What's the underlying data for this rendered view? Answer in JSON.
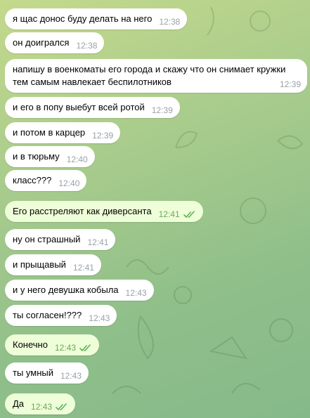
{
  "messages": [
    {
      "text": "я щас донос буду делать на него",
      "time": "12:38",
      "dir": "in"
    },
    {
      "text": "он доигрался",
      "time": "12:38",
      "dir": "in"
    },
    {
      "text": "напишу в военкоматы его города и скажу что он снимает кружки тем самым навлекает беспилотников",
      "time": "12:39",
      "dir": "in"
    },
    {
      "text": "и его в попу выебут всей ротой",
      "time": "12:39",
      "dir": "in"
    },
    {
      "text": "и потом в карцер",
      "time": "12:39",
      "dir": "in"
    },
    {
      "text": "и в тюрьму",
      "time": "12:40",
      "dir": "in"
    },
    {
      "text": "класс???",
      "time": "12:40",
      "dir": "in"
    },
    {
      "text": "Его расстреляют как диверсанта",
      "time": "12:41",
      "dir": "out"
    },
    {
      "text": "ну он страшный",
      "time": "12:41",
      "dir": "in"
    },
    {
      "text": "и прыщавый",
      "time": "12:41",
      "dir": "in"
    },
    {
      "text": "и у него девушка кобыла",
      "time": "12:43",
      "dir": "in"
    },
    {
      "text": "ты согласен!???",
      "time": "12:43",
      "dir": "in"
    },
    {
      "text": "Конечно",
      "time": "12:43",
      "dir": "out"
    },
    {
      "text": "ты умный",
      "time": "12:43",
      "dir": "in"
    },
    {
      "text": "Да",
      "time": "12:43",
      "dir": "out"
    }
  ],
  "colors": {
    "incoming_bubble": "#ffffff",
    "outgoing_bubble": "#eefed8",
    "outgoing_time": "#6ca75c",
    "incoming_time": "#9aa1a8",
    "read_ticks": "#5fb05a"
  },
  "icons": {
    "read_status": "double-check-icon"
  }
}
